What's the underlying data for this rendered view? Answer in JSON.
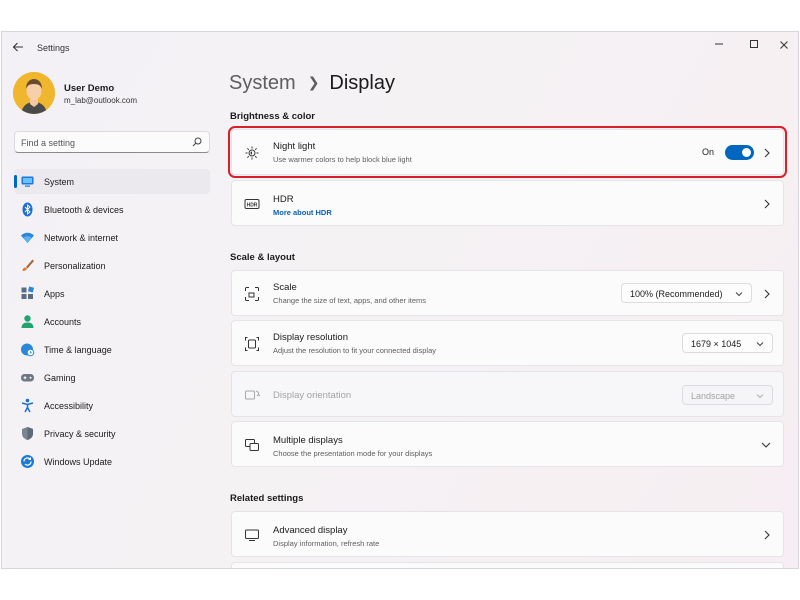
{
  "window": {
    "title": "Settings"
  },
  "profile": {
    "name": "User Demo",
    "email": "m_lab@outlook.com"
  },
  "search": {
    "placeholder": "Find a setting"
  },
  "nav": {
    "items": [
      {
        "label": "System",
        "icon": "system-icon",
        "active": true
      },
      {
        "label": "Bluetooth & devices",
        "icon": "bluetooth-icon"
      },
      {
        "label": "Network & internet",
        "icon": "wifi-icon"
      },
      {
        "label": "Personalization",
        "icon": "brush-icon"
      },
      {
        "label": "Apps",
        "icon": "apps-icon"
      },
      {
        "label": "Accounts",
        "icon": "person-icon"
      },
      {
        "label": "Time & language",
        "icon": "globe-clock-icon"
      },
      {
        "label": "Gaming",
        "icon": "gamepad-icon"
      },
      {
        "label": "Accessibility",
        "icon": "accessibility-icon"
      },
      {
        "label": "Privacy & security",
        "icon": "shield-icon"
      },
      {
        "label": "Windows Update",
        "icon": "update-icon"
      }
    ]
  },
  "breadcrumb": {
    "parent": "System",
    "current": "Display"
  },
  "sections": {
    "brightness": "Brightness & color",
    "scale_layout": "Scale & layout",
    "related": "Related settings"
  },
  "night_light": {
    "title": "Night light",
    "subtitle": "Use warmer colors to help block blue light",
    "state_label": "On",
    "enabled": true
  },
  "hdr": {
    "title": "HDR",
    "link": "More about HDR"
  },
  "scale": {
    "title": "Scale",
    "subtitle": "Change the size of text, apps, and other items",
    "value": "100% (Recommended)"
  },
  "resolution": {
    "title": "Display resolution",
    "subtitle": "Adjust the resolution to fit your connected display",
    "value": "1679 × 1045"
  },
  "orientation": {
    "title": "Display orientation",
    "value": "Landscape",
    "disabled": true
  },
  "multiple_displays": {
    "title": "Multiple displays",
    "subtitle": "Choose the presentation mode for your displays"
  },
  "advanced_display": {
    "title": "Advanced display",
    "subtitle": "Display information, refresh rate"
  },
  "colors": {
    "accent": "#0067c0",
    "highlight": "#d9202a"
  }
}
